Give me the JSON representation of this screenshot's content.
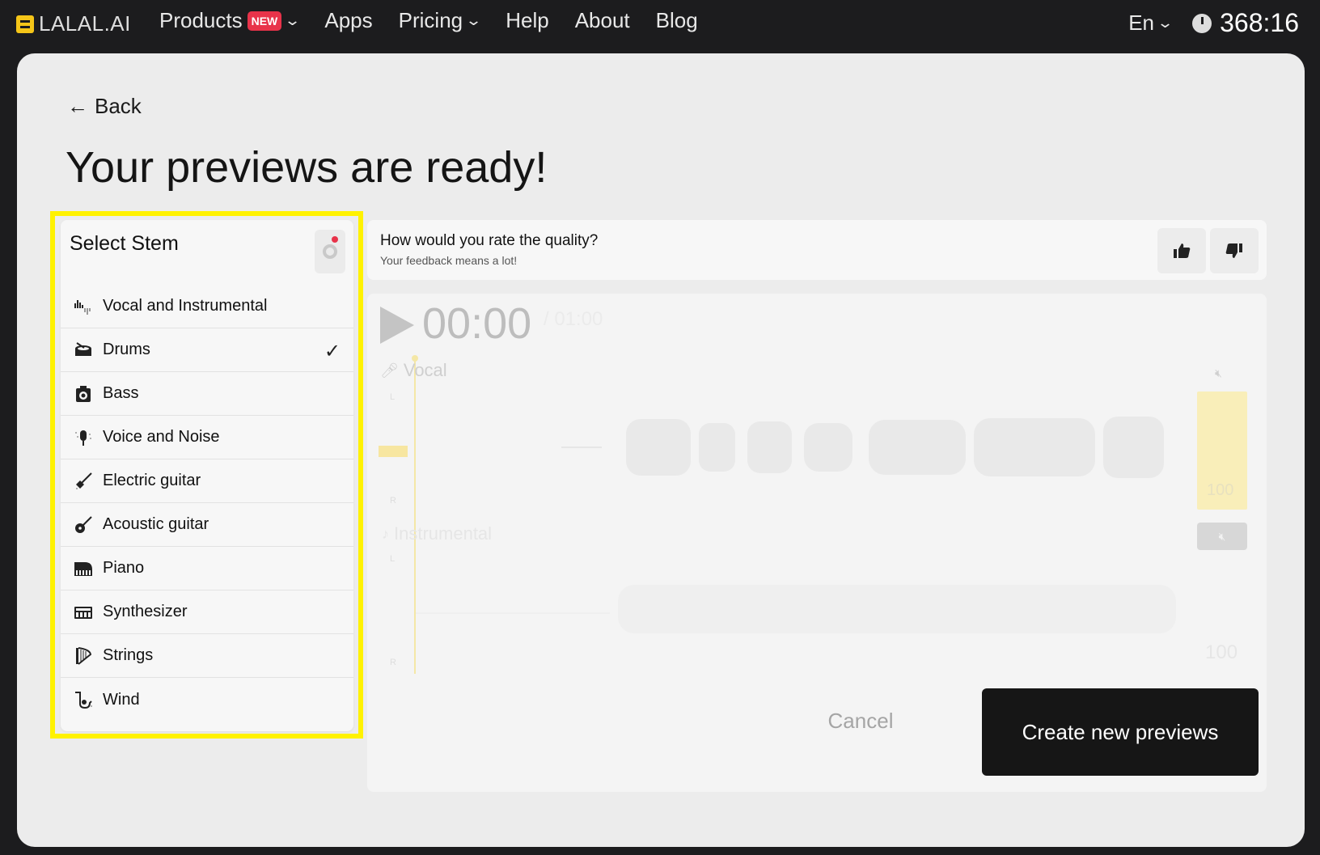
{
  "nav": {
    "logo": "LALAL.AI",
    "products": "Products",
    "products_badge": "NEW",
    "apps": "Apps",
    "pricing": "Pricing",
    "help": "Help",
    "about": "About",
    "blog": "Blog",
    "language": "En",
    "timer": "368:16"
  },
  "page": {
    "back": "Back",
    "title": "Your previews are ready!"
  },
  "stems": {
    "title": "Select Stem",
    "items": [
      {
        "label": "Vocal and Instrumental",
        "icon": "waveform-icon",
        "selected": false
      },
      {
        "label": "Drums",
        "icon": "drum-icon",
        "selected": true
      },
      {
        "label": "Bass",
        "icon": "bass-amp-icon",
        "selected": false
      },
      {
        "label": "Voice and Noise",
        "icon": "microphone-noise-icon",
        "selected": false
      },
      {
        "label": "Electric guitar",
        "icon": "electric-guitar-icon",
        "selected": false
      },
      {
        "label": "Acoustic guitar",
        "icon": "acoustic-guitar-icon",
        "selected": false
      },
      {
        "label": "Piano",
        "icon": "piano-icon",
        "selected": false
      },
      {
        "label": "Synthesizer",
        "icon": "synthesizer-icon",
        "selected": false
      },
      {
        "label": "Strings",
        "icon": "harp-icon",
        "selected": false
      },
      {
        "label": "Wind",
        "icon": "wind-instrument-icon",
        "selected": false
      }
    ]
  },
  "rating": {
    "question": "How would you rate the quality?",
    "subtitle": "Your feedback means a lot!"
  },
  "player": {
    "time": "00:00",
    "duration": "/ 01:00",
    "track1": "Vocal",
    "track2": "Instrumental",
    "channel_l": "L",
    "channel_r": "R",
    "volume1": "100",
    "volume2": "100",
    "accent_color": "#f9eeb9"
  },
  "actions": {
    "cancel": "Cancel",
    "create": "Create new previews"
  },
  "colors": {
    "background": "#1c1c1e",
    "card": "#ececec",
    "highlight": "#fff200",
    "badge": "#e8334a",
    "primary_button": "#161616"
  }
}
